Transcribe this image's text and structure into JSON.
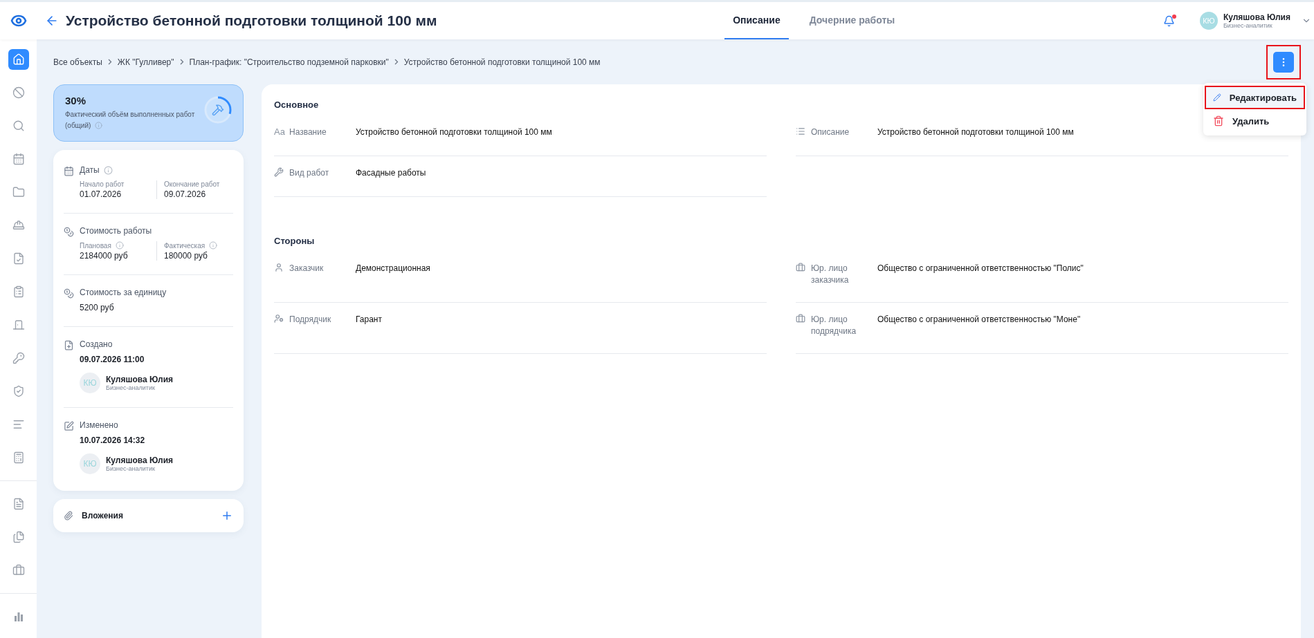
{
  "header": {
    "title": "Устройство бетонной подготовки толщиной 100 мм",
    "tabs": [
      {
        "label": "Описание",
        "selected": true
      },
      {
        "label": "Дочерние работы",
        "selected": false
      }
    ],
    "notifications": {
      "unread": true
    },
    "user": {
      "initials": "КЮ",
      "name": "Куляшова Юлия",
      "role": "Бизнес-аналитик"
    }
  },
  "sidebar": {
    "groups": [
      [
        {
          "kind": "home",
          "selected": true
        },
        {
          "kind": "blocked",
          "selected": false
        },
        {
          "kind": "search",
          "selected": false
        },
        {
          "kind": "calendar",
          "selected": false
        },
        {
          "kind": "folder",
          "selected": false
        },
        {
          "kind": "helmet",
          "selected": false
        },
        {
          "kind": "checklist",
          "selected": false
        },
        {
          "kind": "clipboard",
          "selected": false
        },
        {
          "kind": "door",
          "selected": false
        },
        {
          "kind": "key",
          "selected": false
        },
        {
          "kind": "shield",
          "selected": false
        },
        {
          "kind": "gantt",
          "selected": false
        },
        {
          "kind": "calculator",
          "selected": false
        }
      ],
      [
        {
          "kind": "document",
          "selected": false
        },
        {
          "kind": "documents",
          "selected": false
        },
        {
          "kind": "briefcase",
          "selected": false
        }
      ],
      [
        {
          "kind": "chart",
          "selected": false
        }
      ]
    ]
  },
  "breadcrumbs": [
    "Все объекты",
    "ЖК \"Гулливер\"",
    "План-график: \"Строительство подземной парковки\"",
    "Устройство бетонной подготовки толщиной 100 мм"
  ],
  "more_button": {
    "highlighted": true
  },
  "menu": {
    "items": [
      {
        "kind": "edit",
        "label": "Редактировать",
        "highlighted": true
      },
      {
        "kind": "delete",
        "label": "Удалить",
        "highlighted": false
      }
    ]
  },
  "progress": {
    "value": "30%",
    "label": "Фактический объём выполненных работ (общий)",
    "level": 0.3,
    "info": true
  },
  "info_sections": [
    {
      "kind": "dates",
      "title": "Даты",
      "info": true,
      "fields": [
        {
          "label": "Начало работ",
          "value": "01.07.2026",
          "info": false
        },
        {
          "label": "Окончание работ",
          "value": "09.07.2026",
          "info": false
        }
      ]
    },
    {
      "kind": "cost",
      "title": "Стоимость работы",
      "info": false,
      "fields": [
        {
          "label": "Плановая",
          "value": "2184000 руб",
          "info": true
        },
        {
          "label": "Фактическая",
          "value": "180000 руб",
          "info": true
        }
      ]
    },
    {
      "kind": "unit_cost",
      "title": "Стоимость за единицу",
      "info": false,
      "value": "5200 руб"
    },
    {
      "kind": "created",
      "title": "Создано",
      "info": false,
      "value": "09.07.2026 11:00",
      "user": {
        "initials": "КЮ",
        "name": "Куляшова Юлия",
        "role": "Бизнес-аналитик"
      }
    },
    {
      "kind": "modified",
      "title": "Изменено",
      "info": false,
      "value": "10.07.2026 14:32",
      "user": {
        "initials": "КЮ",
        "name": "Куляшова Юлия",
        "role": "Бизнес-аналитик"
      }
    }
  ],
  "attachments": {
    "label": "Вложения"
  },
  "sections": [
    {
      "title": "Основное",
      "fields": [
        {
          "kind": "name",
          "glyph": "Aa",
          "label": "Название",
          "value": "Устройство бетонной подготовки толщиной 100 мм"
        },
        {
          "kind": "description",
          "label": "Описание",
          "value": "Устройство бетонной подготовки толщиной 100 мм"
        },
        {
          "kind": "work_type",
          "label": "Вид работ",
          "value": "Фасадные работы"
        }
      ]
    },
    {
      "title": "Стороны",
      "fields": [
        {
          "kind": "customer",
          "label": "Заказчик",
          "value": "Демонстрационная"
        },
        {
          "kind": "legal",
          "label": "Юр. лицо заказчика",
          "value": "Общество с ограниченной ответственностью \"Полис\""
        },
        {
          "kind": "contractor",
          "label": "Подрядчик",
          "value": "Гарант"
        },
        {
          "kind": "legal",
          "label": "Юр. лицо подрядчика",
          "value": "Общество с ограниченной ответственностью \"Моне\""
        }
      ]
    }
  ]
}
